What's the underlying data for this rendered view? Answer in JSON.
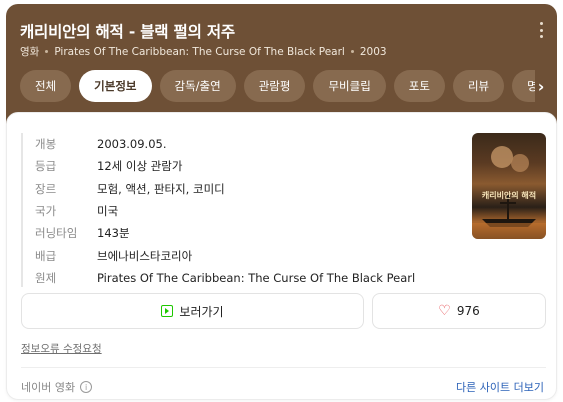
{
  "header": {
    "title": "캐리비안의 해적 - 블랙 펄의 저주",
    "category": "영화",
    "original_title": "Pirates Of The Caribbean: The Curse Of The Black Pearl",
    "year": "2003"
  },
  "tabs": [
    {
      "label": "전체",
      "active": false
    },
    {
      "label": "기본정보",
      "active": true
    },
    {
      "label": "감독/출연",
      "active": false
    },
    {
      "label": "관람평",
      "active": false
    },
    {
      "label": "무비클립",
      "active": false
    },
    {
      "label": "포토",
      "active": false
    },
    {
      "label": "리뷰",
      "active": false
    },
    {
      "label": "명대사",
      "active": false
    }
  ],
  "info": [
    {
      "key": "개봉",
      "value": "2003.09.05."
    },
    {
      "key": "등급",
      "value": "12세 이상 관람가"
    },
    {
      "key": "장르",
      "value": "모험, 액션, 판타지, 코미디"
    },
    {
      "key": "국가",
      "value": "미국"
    },
    {
      "key": "러닝타임",
      "value": "143분"
    },
    {
      "key": "배급",
      "value": "브에나비스타코리아"
    },
    {
      "key": "원제",
      "value": "Pirates Of The Caribbean: The Curse Of The Black Pearl"
    }
  ],
  "poster": {
    "title_text": "캐리비안의 해적"
  },
  "actions": {
    "watch_label": "보러가기",
    "like_count": "976"
  },
  "report_link": "정보오류 수정요청",
  "footer": {
    "source": "네이버 영화",
    "more_sites": "다른 사이트 더보기"
  },
  "colors": {
    "header_bg": "#6e5036",
    "watch_icon": "#1ec800",
    "heart": "#e5484d",
    "link": "#2c62b8"
  }
}
